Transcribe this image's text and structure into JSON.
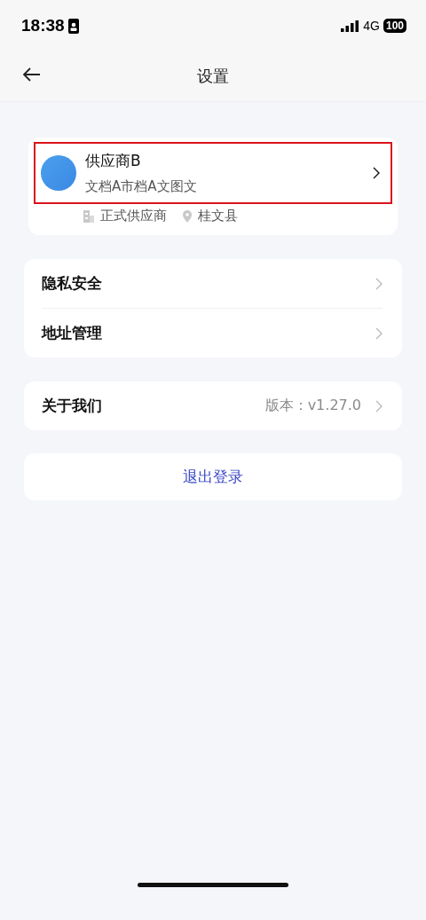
{
  "status_bar": {
    "time": "18:38",
    "network": "4G",
    "battery": "100"
  },
  "nav": {
    "title": "设置"
  },
  "profile": {
    "name": "供应商B",
    "subtitle": "文档A市档A文图文",
    "highlighted": true,
    "tags": [
      {
        "kind": "building",
        "text": "正式供应商"
      },
      {
        "kind": "location",
        "text": "桂文县"
      }
    ]
  },
  "menu_groups": [
    {
      "items": [
        {
          "label": "隐私安全"
        },
        {
          "label": "地址管理"
        }
      ]
    },
    {
      "items": [
        {
          "label": "关于我们",
          "value": "版本：v1.27.0"
        }
      ]
    }
  ],
  "logout": {
    "label": "退出登录"
  }
}
